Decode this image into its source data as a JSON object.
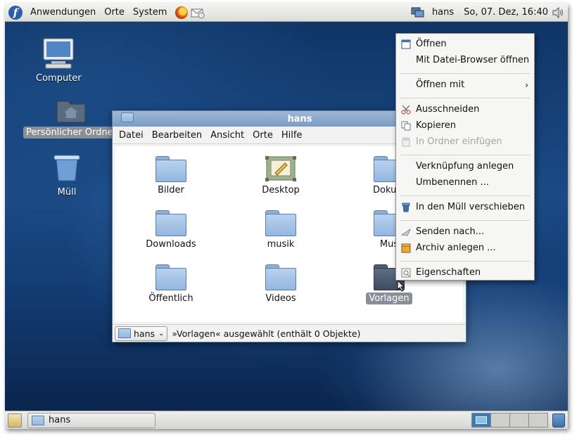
{
  "top_panel": {
    "menus": [
      "Anwendungen",
      "Orte",
      "System"
    ],
    "user": "hans",
    "clock": "So, 07. Dez, 16:40"
  },
  "desktop": {
    "icons": [
      {
        "label": "Computer"
      },
      {
        "label": "Persönlicher Ordner"
      },
      {
        "label": "Müll"
      }
    ]
  },
  "file_manager": {
    "title": "hans",
    "menus": [
      "Datei",
      "Bearbeiten",
      "Ansicht",
      "Orte",
      "Hilfe"
    ],
    "items": [
      "Bilder",
      "Desktop",
      "Dokum",
      "Downloads",
      "musik",
      "Mus",
      "Öffentlich",
      "Videos",
      "Vorlagen"
    ],
    "location_button": "hans",
    "status": "»Vorlagen« ausgewählt (enthält 0 Objekte)"
  },
  "context_menu": {
    "items": [
      {
        "label": "Öffnen",
        "icon": "open-icon",
        "disabled": false
      },
      {
        "label": "Mit Datei-Browser öffnen",
        "icon": "",
        "disabled": false
      },
      {
        "label": "Öffnen mit",
        "icon": "",
        "disabled": false,
        "submenu": true
      },
      {
        "label": "Ausschneiden",
        "icon": "scissors-icon",
        "disabled": false
      },
      {
        "label": "Kopieren",
        "icon": "copy-icon",
        "disabled": false
      },
      {
        "label": "In Ordner einfügen",
        "icon": "paste-icon",
        "disabled": true
      },
      {
        "label": "Verknüpfung anlegen",
        "icon": "",
        "disabled": false
      },
      {
        "label": "Umbenennen ...",
        "icon": "",
        "disabled": false
      },
      {
        "label": "In den Müll verschieben",
        "icon": "trash-icon",
        "disabled": false
      },
      {
        "label": "Senden nach...",
        "icon": "send-icon",
        "disabled": false
      },
      {
        "label": "Archiv anlegen ...",
        "icon": "archive-icon",
        "disabled": false
      },
      {
        "label": "Eigenschaften",
        "icon": "properties-icon",
        "disabled": false
      }
    ],
    "submenu_arrow": "›"
  },
  "bottom_panel": {
    "task": "hans"
  },
  "colors": {
    "accent": "#3f7ab8",
    "selection": "#8a8f97"
  }
}
